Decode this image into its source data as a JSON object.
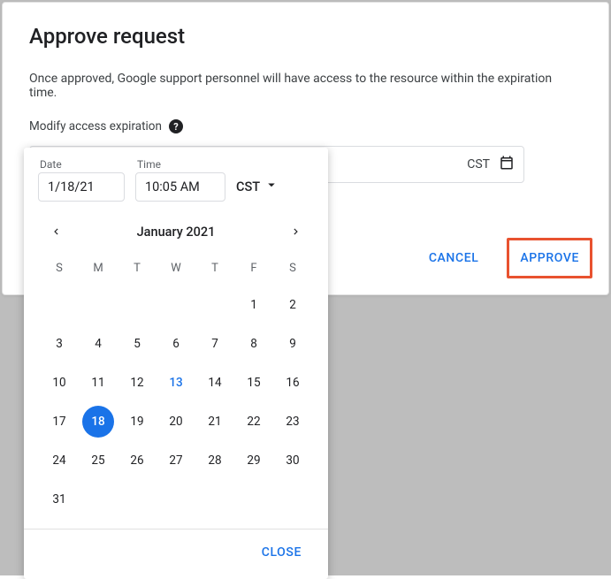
{
  "dialog": {
    "title": "Approve request",
    "description": "Once approved, Google support personnel will have access to the resource within the expiration time.",
    "modify_label": "Modify access expiration",
    "underlying_tz": "CST",
    "cancel_label": "CANCEL",
    "approve_label": "APPROVE"
  },
  "datepicker": {
    "date_label": "Date",
    "date_value": "1/18/21",
    "time_label": "Time",
    "time_value": "10:05 AM",
    "tz": "CST",
    "month_title": "January 2021",
    "dow": [
      "S",
      "M",
      "T",
      "W",
      "T",
      "F",
      "S"
    ],
    "days": [
      {
        "n": "",
        "t": "empty"
      },
      {
        "n": "",
        "t": "empty"
      },
      {
        "n": "",
        "t": "empty"
      },
      {
        "n": "",
        "t": "empty"
      },
      {
        "n": "",
        "t": "empty"
      },
      {
        "n": "1",
        "t": ""
      },
      {
        "n": "2",
        "t": ""
      },
      {
        "n": "3",
        "t": ""
      },
      {
        "n": "4",
        "t": ""
      },
      {
        "n": "5",
        "t": ""
      },
      {
        "n": "6",
        "t": ""
      },
      {
        "n": "7",
        "t": ""
      },
      {
        "n": "8",
        "t": ""
      },
      {
        "n": "9",
        "t": ""
      },
      {
        "n": "10",
        "t": ""
      },
      {
        "n": "11",
        "t": ""
      },
      {
        "n": "12",
        "t": ""
      },
      {
        "n": "13",
        "t": "today"
      },
      {
        "n": "14",
        "t": ""
      },
      {
        "n": "15",
        "t": ""
      },
      {
        "n": "16",
        "t": ""
      },
      {
        "n": "17",
        "t": ""
      },
      {
        "n": "18",
        "t": "selected"
      },
      {
        "n": "19",
        "t": ""
      },
      {
        "n": "20",
        "t": ""
      },
      {
        "n": "21",
        "t": ""
      },
      {
        "n": "22",
        "t": ""
      },
      {
        "n": "23",
        "t": ""
      },
      {
        "n": "24",
        "t": ""
      },
      {
        "n": "25",
        "t": ""
      },
      {
        "n": "26",
        "t": ""
      },
      {
        "n": "27",
        "t": ""
      },
      {
        "n": "28",
        "t": ""
      },
      {
        "n": "29",
        "t": ""
      },
      {
        "n": "30",
        "t": ""
      },
      {
        "n": "31",
        "t": ""
      }
    ],
    "close_label": "CLOSE"
  }
}
